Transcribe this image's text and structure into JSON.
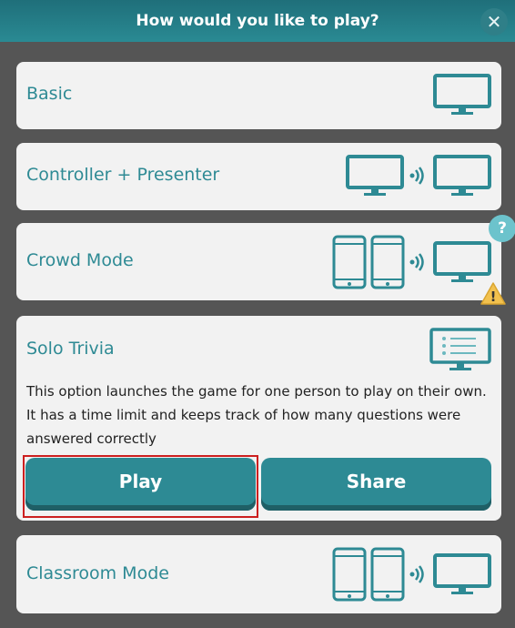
{
  "dialog": {
    "title": "How would you like to play?",
    "close_symbol": "✕"
  },
  "options": {
    "basic": {
      "label": "Basic",
      "icons": [
        "monitor-icon"
      ]
    },
    "controller_presenter": {
      "label": "Controller + Presenter",
      "icons": [
        "monitor-icon",
        "wireless-icon",
        "monitor-icon"
      ]
    },
    "crowd_mode": {
      "label": "Crowd Mode",
      "icons": [
        "phone-icon",
        "phone-icon",
        "wireless-icon",
        "monitor-icon"
      ]
    },
    "solo_trivia": {
      "label": "Solo Trivia",
      "icons": [
        "checklist-monitor-icon"
      ],
      "description": "This option launches the game for one person to play on their own. It has a time limit and keeps track of how many questions were answered correctly",
      "play_label": "Play",
      "share_label": "Share",
      "selected": true
    },
    "classroom_mode": {
      "label": "Classroom Mode",
      "icons": [
        "phone-icon",
        "phone-icon",
        "wireless-icon",
        "monitor-icon"
      ]
    }
  },
  "badges": {
    "help": "?",
    "warning": "!"
  },
  "colors": {
    "accent": "#2e8a94",
    "header": "#237a84",
    "backdrop": "#555555",
    "card": "#f2f2f2",
    "highlight": "#cc1f1f",
    "warning": "#f2c14e"
  }
}
